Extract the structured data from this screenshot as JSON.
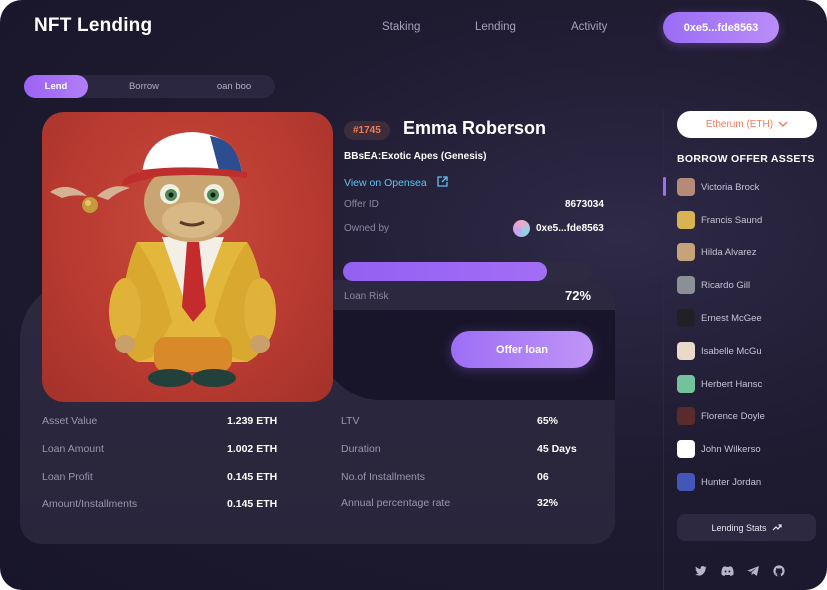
{
  "app": {
    "title": "NFT Lending"
  },
  "nav": {
    "items": [
      "Staking",
      "Lending",
      "Activity"
    ],
    "wallet": "0xe5...fde8563"
  },
  "tabs": [
    "Lend",
    "Borrow",
    "oan boo"
  ],
  "nft": {
    "token": "#1745",
    "name": "Emma Roberson",
    "collection": "BBsEA:Exotic Apes (Genesis)",
    "opensea_link": "View on Opensea",
    "offer_id_label": "Offer ID",
    "offer_id": "8673034",
    "owned_by_label": "Owned by",
    "owner": "0xe5...fde8563",
    "loan_risk_label": "Loan Risk",
    "loan_risk_percent": "72%",
    "loan_risk_value": 0.82,
    "offer_button": "Offer loan"
  },
  "stats": [
    {
      "label": "Asset Value",
      "value": "1.239 ETH"
    },
    {
      "label": "Loan Amount",
      "value": "1.002 ETH"
    },
    {
      "label": "Loan Profit",
      "value": "0.145 ETH"
    },
    {
      "label": "Amount/Installments",
      "value": "0.145 ETH"
    },
    {
      "label": "LTV",
      "value": "65%"
    },
    {
      "label": "Duration",
      "value": "45 Days"
    },
    {
      "label": "No.of Installments",
      "value": "06"
    },
    {
      "label": "Annual percentage rate",
      "value": "32%"
    }
  ],
  "sidebar": {
    "chain": "Etherum (ETH)",
    "title": "BORROW OFFER ASSETS",
    "assets": [
      {
        "name": "Victoria Brock",
        "color": "#b58a78"
      },
      {
        "name": "Francis Saund",
        "color": "#d9b252"
      },
      {
        "name": "Hilda Alvarez",
        "color": "#c7a37a"
      },
      {
        "name": "Ricardo Gill",
        "color": "#8b8f96"
      },
      {
        "name": "Ernest McGee",
        "color": "#222026"
      },
      {
        "name": "Isabelle McGu",
        "color": "#e8d9c8"
      },
      {
        "name": "Herbert Hansc",
        "color": "#74c29b"
      },
      {
        "name": "Florence Doyle",
        "color": "#5b2a2a"
      },
      {
        "name": "John Wilkerso",
        "color": "#ffffff"
      },
      {
        "name": "Hunter Jordan",
        "color": "#4456b7"
      }
    ],
    "stats_button": "Lending Stats"
  },
  "colors": {
    "accent": "#9d6ef5",
    "badge": "#f07b5b",
    "link": "#5ec3f0",
    "background": "#1f1b31"
  }
}
